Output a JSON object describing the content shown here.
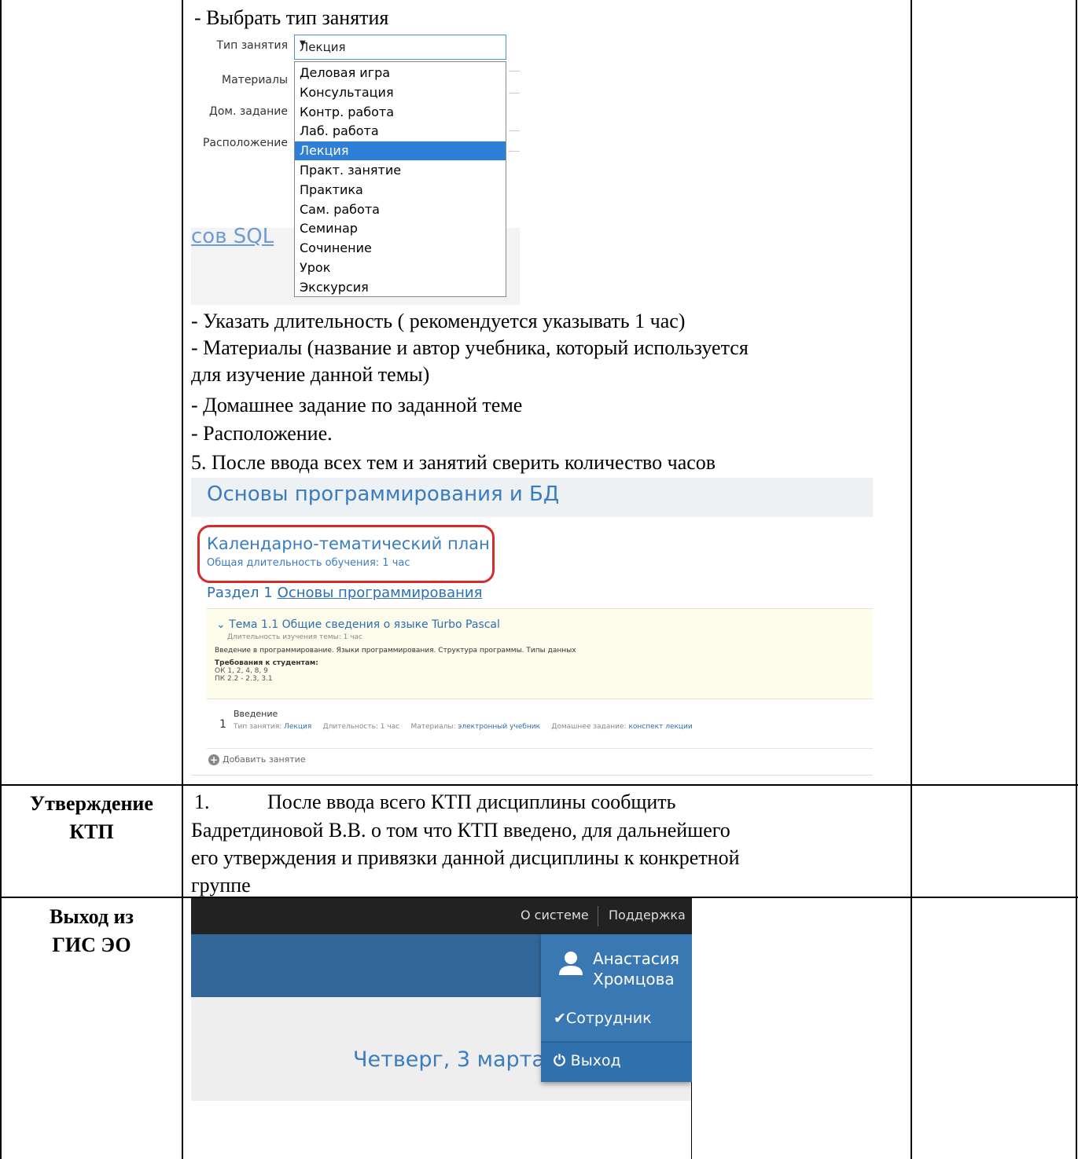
{
  "step_choose_type": "- Выбрать тип занятия",
  "form": {
    "label_type": "Тип занятия",
    "label_materials": "Материалы",
    "label_homework": "Дом. задание",
    "label_location": "Расположение",
    "selected_value": "Лекция",
    "options": [
      "Деловая игра",
      "Консультация",
      "Контр. работа",
      "Лаб. работа",
      "Лекция",
      "Практ. занятие",
      "Практика",
      "Сам. работа",
      "Семинар",
      "Сочинение",
      "Урок",
      "Экскурсия"
    ],
    "background_link_fragment": "сов SQL"
  },
  "instructions": [
    "- Указать длительность ( рекомендуется указывать 1 час)",
    "- Материалы (название и автор учебника, который используется",
    "для изучение данной темы)",
    "- Домашнее задание по заданной теме",
    "- Расположение.",
    "5. После ввода всех тем и занятий сверить количество часов"
  ],
  "ktp": {
    "course_title": "Основы программирования и БД",
    "plan_title": "Календарно-тематический план",
    "plan_subtitle": "Общая длительность обучения: 1 час",
    "section_label": "Раздел 1",
    "section_link": "Основы программирования",
    "topic_title": "Тема 1.1   Общие сведения о языке Turbo Pascal",
    "topic_duration": "Длительность изучения темы: 1 час",
    "topic_description": "Введение в программирование. Языки программирования. Структура программы. Типы данных",
    "requirements_title": "Требования к студентам:",
    "requirements_ok": "ОК 1, 2, 4, 8, 9",
    "requirements_pk": "ПК 2.2 - 2.3, 3.1",
    "lesson_number": "1",
    "lesson_name": "Введение",
    "lesson_type_label": "Тип занятия:",
    "lesson_type_value": "Лекция",
    "lesson_duration": "Длительность: 1 час",
    "lesson_materials_label": "Материалы:",
    "lesson_materials_value": "электронный учебник",
    "lesson_homework_label": "Домашнее задание:",
    "lesson_homework_value": "конспект лекции",
    "add_lesson": "Добавить занятие"
  },
  "approval": {
    "label_line1": "Утверждение",
    "label_line2": "КТП",
    "number": "1.",
    "lines": [
      "После ввода всего КТП дисциплины сообщить",
      "Бадретдиновой В.В. о том что КТП введено, для дальнейшего",
      "его утверждения и привязки данной дисциплины к конкретной",
      "группе"
    ]
  },
  "exit": {
    "label_line1": "Выход из",
    "label_line2": "ГИС ЭО",
    "top_about": "О системе",
    "top_support": "Поддержка",
    "user_first": "Анастасия",
    "user_last": "Хромцова",
    "role": "Сотрудник",
    "logout": "Выход",
    "date_text": "Четверг, 3 марта"
  }
}
